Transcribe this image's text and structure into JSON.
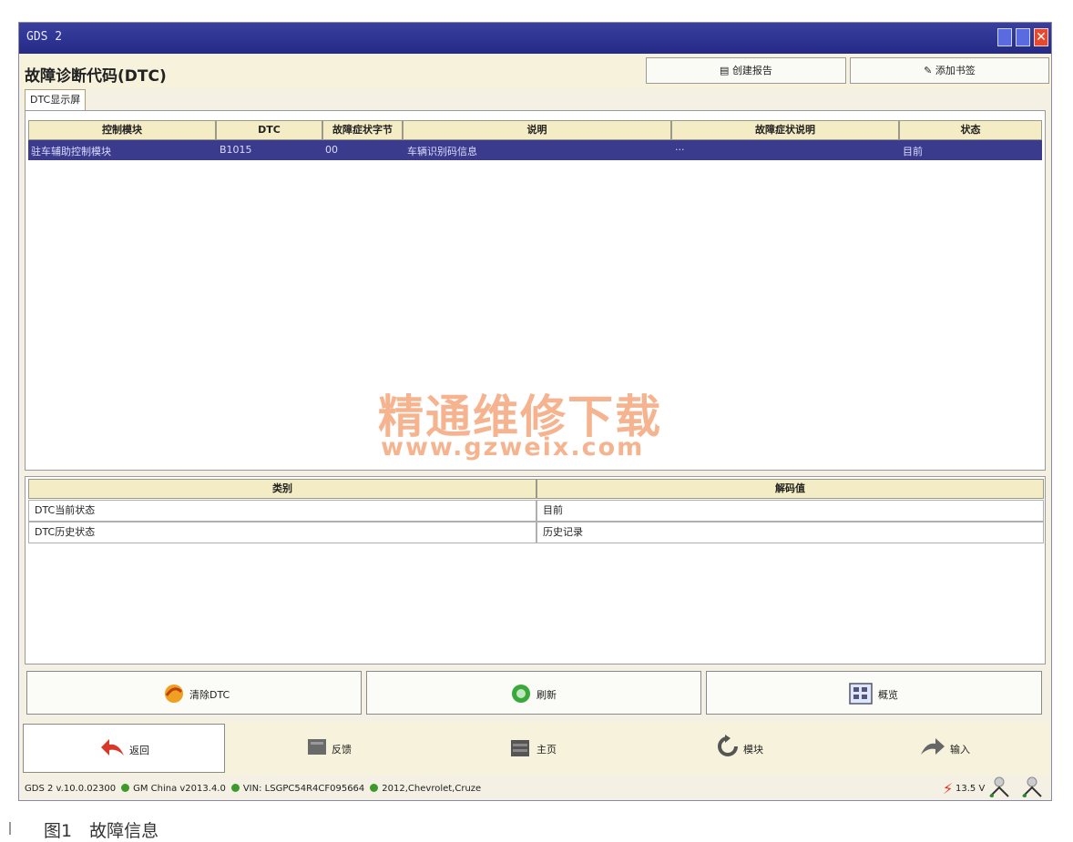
{
  "window": {
    "title": "GDS 2"
  },
  "header": {
    "title": "故障诊断代码(DTC)",
    "create_report": "创建报告",
    "add_bookmark": "添加书签"
  },
  "tab": {
    "label": "DTC显示屏"
  },
  "dtc_table": {
    "columns": [
      "控制模块",
      "DTC",
      "故障症状字节",
      "说明",
      "故障症状说明",
      "状态"
    ],
    "rows": [
      {
        "module": "驻车辅助控制模块",
        "dtc": "B1015",
        "symptom_byte": "00",
        "description": "车辆识别码信息",
        "symptom_description": "···",
        "status": "目前"
      }
    ]
  },
  "detail_table": {
    "columns": [
      "类别",
      "解码值"
    ],
    "rows": [
      {
        "category": "DTC当前状态",
        "value": "目前"
      },
      {
        "category": "DTC历史状态",
        "value": "历史记录"
      }
    ]
  },
  "actions": {
    "clear_dtc": "清除DTC",
    "refresh": "刷新",
    "overview": "概览"
  },
  "nav": {
    "back": "返回",
    "feedback": "反馈",
    "home": "主页",
    "module": "模块",
    "enter": "输入"
  },
  "status_bar": {
    "version": "GDS 2 v.10.0.02300",
    "data": "GM China v2013.4.0",
    "vin": "VIN: LSGPC54R4CF095664",
    "vehicle": "2012,Chevrolet,Cruze",
    "voltage": "13.5 V"
  },
  "watermark": {
    "line1": "精通维修下载",
    "line2": "www.gzweix.com"
  },
  "caption": "图1　故障信息",
  "colors": {
    "title_bar": "#2a2f8f",
    "selected_row": "#3a3b8d",
    "header_cell": "#f4ecc4",
    "watermark": "#f3a070"
  }
}
